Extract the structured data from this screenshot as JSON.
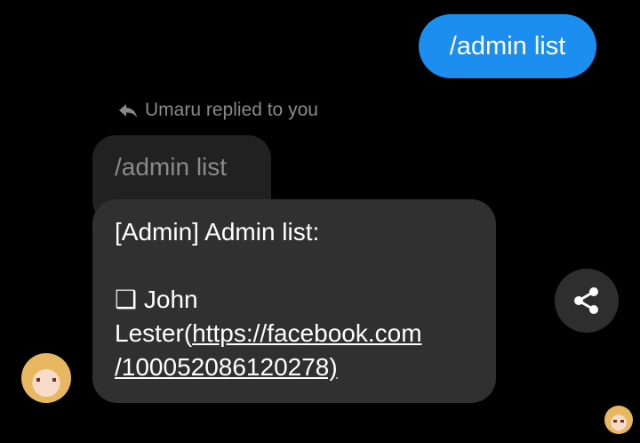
{
  "sent_message": {
    "text": "/admin list",
    "color": "#1b8ef0"
  },
  "reply": {
    "label": "Umaru replied to you",
    "icon": "reply-icon"
  },
  "quoted_message": {
    "text": "/admin list"
  },
  "received_message": {
    "line1": "[Admin] Admin list:",
    "bullet": "❑",
    "name_part1": "John",
    "name_part2": "Lester(",
    "link_part1": "https://facebook.com",
    "link_part2": "/100052086120278)"
  },
  "share_button": {
    "icon": "share-icon"
  },
  "sender_avatar": {
    "icon": "avatar"
  },
  "read_receipt": {
    "icon": "avatar"
  }
}
